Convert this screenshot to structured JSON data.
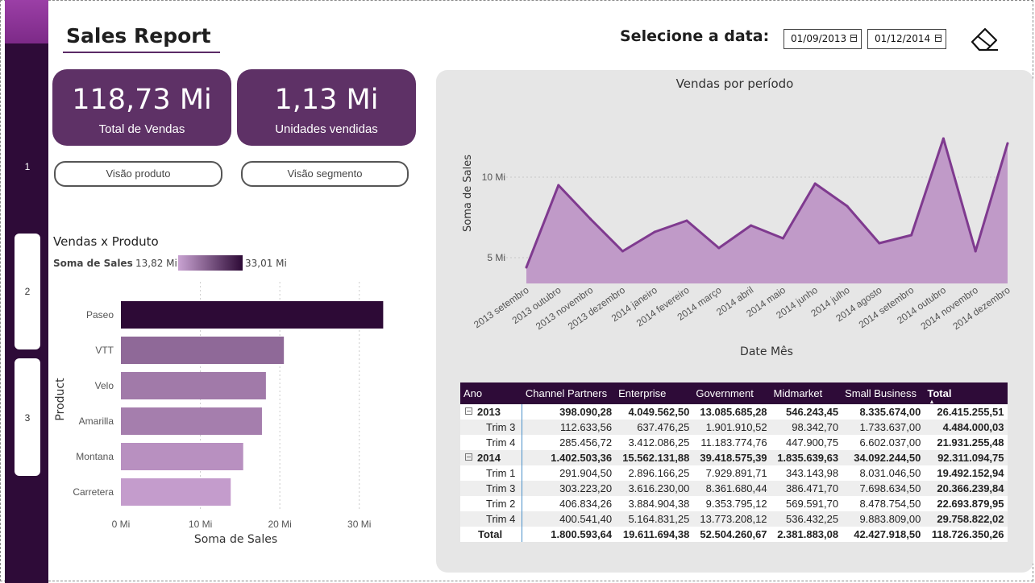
{
  "sidebar": {
    "pages": [
      {
        "label": "1"
      },
      {
        "label": "2"
      },
      {
        "label": "3"
      }
    ]
  },
  "header": {
    "title": "Sales Report",
    "date_label": "Selecione a data:",
    "date_start": "01/09/2013",
    "date_end": "01/12/2014"
  },
  "kpis": [
    {
      "value": "118,73 Mi",
      "label": "Total de Vendas"
    },
    {
      "value": "1,13 Mi",
      "label": "Unidades vendidas"
    }
  ],
  "nav_buttons": {
    "product": "Visão produto",
    "segment": "Visão segmento"
  },
  "colors": {
    "sidebar": "#2e0b38",
    "accent": "#7d2a88",
    "card": "#5e3166",
    "line": "#7f3a8f",
    "area": "#c09ac8"
  },
  "chart_data": [
    {
      "type": "bar",
      "title": "Vendas x Produto",
      "legend": {
        "title": "Soma de  Sales",
        "min_label": "13,82 Mi",
        "max_label": "33,01 Mi"
      },
      "categories": [
        "Paseo",
        "VTT",
        "Velo",
        "Amarilla",
        "Montana",
        "Carretera"
      ],
      "values": [
        33.01,
        20.51,
        18.25,
        17.75,
        15.39,
        13.82
      ],
      "xlabel": "Soma de Sales",
      "ylabel": "Product",
      "xticks": [
        "0 Mi",
        "10 Mi",
        "20 Mi",
        "30 Mi"
      ],
      "xlim": [
        0,
        35
      ]
    },
    {
      "type": "area",
      "title": "Vendas por período",
      "xlabel": "Date Mês",
      "ylabel": "Soma de Sales",
      "categories": [
        "2013 setembro",
        "2013 outubro",
        "2013 novembro",
        "2013 dezembro",
        "2014 janeiro",
        "2014 fevereiro",
        "2014 março",
        "2014 abril",
        "2014 maio",
        "2014 junho",
        "2014 julho",
        "2014 agosto",
        "2014 setembro",
        "2014 outubro",
        "2014 novembro",
        "2014 dezembro"
      ],
      "values": [
        4.4,
        9.5,
        7.4,
        5.4,
        6.6,
        7.3,
        5.6,
        7.0,
        6.2,
        9.6,
        8.2,
        5.9,
        6.4,
        12.4,
        5.4,
        12.1
      ],
      "yticks": [
        {
          "value": 5,
          "label": "5 Mi"
        },
        {
          "value": 10,
          "label": "10 Mi"
        }
      ],
      "ylim": [
        3.4,
        13.5
      ],
      "grid": true
    }
  ],
  "matrix": {
    "headers": [
      "Ano",
      "Channel Partners",
      "Enterprise",
      "Government",
      "Midmarket",
      "Small Business",
      "Total"
    ],
    "rows": [
      {
        "kind": "year",
        "label": "2013",
        "cells": [
          "398.090,28",
          "4.049.562,50",
          "13.085.685,28",
          "546.243,45",
          "8.335.674,00",
          "26.415.255,51"
        ]
      },
      {
        "kind": "sub",
        "label": "Trim 3",
        "cells": [
          "112.633,56",
          "637.476,25",
          "1.901.910,52",
          "98.342,70",
          "1.733.637,00",
          "4.484.000,03"
        ]
      },
      {
        "kind": "sub",
        "label": "Trim 4",
        "cells": [
          "285.456,72",
          "3.412.086,25",
          "11.183.774,76",
          "447.900,75",
          "6.602.037,00",
          "21.931.255,48"
        ]
      },
      {
        "kind": "year",
        "label": "2014",
        "cells": [
          "1.402.503,36",
          "15.562.131,88",
          "39.418.575,39",
          "1.835.639,63",
          "34.092.244,50",
          "92.311.094,75"
        ]
      },
      {
        "kind": "sub",
        "label": "Trim 1",
        "cells": [
          "291.904,50",
          "2.896.166,25",
          "7.929.891,71",
          "343.143,98",
          "8.031.046,50",
          "19.492.152,94"
        ]
      },
      {
        "kind": "sub",
        "label": "Trim 3",
        "cells": [
          "303.223,20",
          "3.616.230,00",
          "8.361.680,44",
          "386.471,70",
          "7.698.634,50",
          "20.366.239,84"
        ]
      },
      {
        "kind": "sub",
        "label": "Trim 2",
        "cells": [
          "406.834,26",
          "3.884.904,38",
          "9.353.795,12",
          "569.591,70",
          "8.478.754,50",
          "22.693.879,95"
        ]
      },
      {
        "kind": "sub",
        "label": "Trim 4",
        "cells": [
          "400.541,40",
          "5.164.831,25",
          "13.773.208,12",
          "536.432,25",
          "9.883.809,00",
          "29.758.822,02"
        ]
      },
      {
        "kind": "total",
        "label": "Total",
        "cells": [
          "1.800.593,64",
          "19.611.694,38",
          "52.504.260,67",
          "2.381.883,08",
          "42.427.918,50",
          "118.726.350,26"
        ]
      }
    ]
  }
}
